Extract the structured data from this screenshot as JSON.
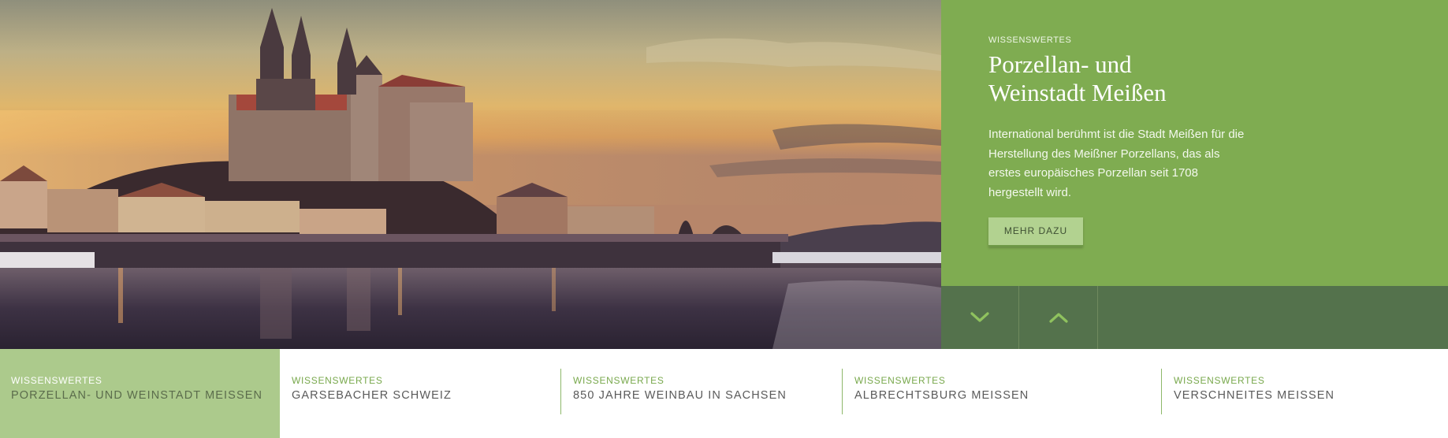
{
  "hero": {
    "image_description_icon": "castle-photo"
  },
  "feature": {
    "eyebrow": "WISSENSWERTES",
    "title_line1": "Porzellan- und",
    "title_line2": "Weinstadt Meißen",
    "text": "International berühmt ist die Stadt Meißen für die Herstellung des Meißner Porzellans, das als erstes europäisches Porzellan seit 1708 hergestellt wird.",
    "button_label": "MEHR DAZU"
  },
  "nav": {
    "down_icon": "chevron-down-icon",
    "up_icon": "chevron-up-icon"
  },
  "tabs": [
    {
      "eyebrow": "WISSENSWERTES",
      "title": "PORZELLAN- UND WEINSTADT MEISSEN",
      "active": true
    },
    {
      "eyebrow": "WISSENSWERTES",
      "title": "GARSEBACHER SCHWEIZ",
      "active": false
    },
    {
      "eyebrow": "WISSENSWERTES",
      "title": "850 JAHRE WEINBAU IN SACHSEN",
      "active": false
    },
    {
      "eyebrow": "WISSENSWERTES",
      "title": "ALBRECHTSBURG MEISSEN",
      "active": false
    },
    {
      "eyebrow": "WISSENSWERTES",
      "title": "VERSCHNEITES MEISSEN",
      "active": false
    }
  ],
  "colors": {
    "panel_green": "#7fac51",
    "arrow_bar": "#54724c",
    "active_tab": "#acca8c",
    "accent_text": "#78a84c",
    "button": "#b2d290"
  }
}
